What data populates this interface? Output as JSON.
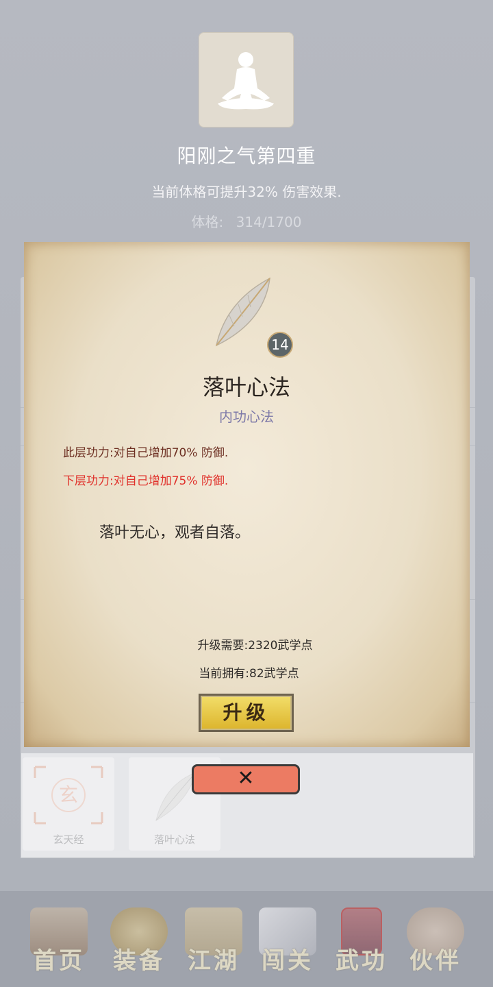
{
  "header": {
    "realm_title": "阳刚之气第四重",
    "realm_desc": "当前体格可提升32% 伤害效果.",
    "physique_label": "体格:",
    "physique_value": "314/1700"
  },
  "skill_detail": {
    "level": "14",
    "name": "落叶心法",
    "type": "内功心法",
    "current_effect": "此层功力:对自己增加70% 防御.",
    "next_effect": "下层功力:对自己增加75% 防御.",
    "quote": "落叶无心，观者自落。",
    "requirement": "升级需要:2320武学点",
    "owned": "当前拥有:82武学点",
    "upgrade_label": "升级",
    "close_label": "✕"
  },
  "skill_list": [
    {
      "label": "玄天经",
      "icon": "xuan-seal-icon"
    },
    {
      "label": "落叶心法",
      "icon": "leaf-icon"
    }
  ],
  "nav": [
    {
      "label": "首页",
      "icon": "house-icon"
    },
    {
      "label": "装备",
      "icon": "armor-icon"
    },
    {
      "label": "江湖",
      "icon": "scroll-map-icon"
    },
    {
      "label": "闯关",
      "icon": "crossed-swords-icon"
    },
    {
      "label": "武功",
      "icon": "manual-book-icon"
    },
    {
      "label": "伙伴",
      "icon": "companions-icon"
    }
  ],
  "colors": {
    "next_effect": "#e0302a",
    "current_effect": "#6d2f22",
    "skill_type": "#7d79a8",
    "close_button": "#ec7b63",
    "upgrade_button": "#dcb42c"
  }
}
